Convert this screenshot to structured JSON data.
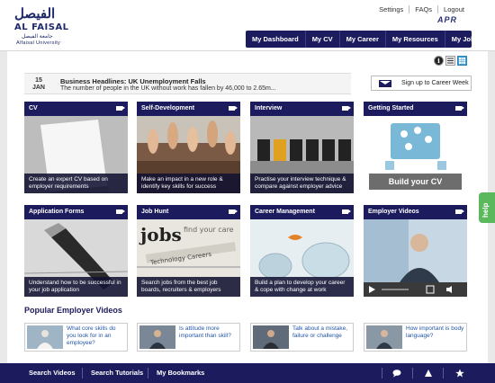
{
  "header": {
    "logo": {
      "arabic": "الفيصل",
      "latin": "AL FAISAL",
      "sub_arabic": "جامعة الفيصل",
      "sub": "Alfaisal University"
    },
    "util_links": [
      "Settings",
      "FAQs",
      "Logout"
    ],
    "apr_logo": "APR",
    "nav": [
      "My Dashboard",
      "My CV",
      "My Career",
      "My Resources",
      "My Jobs"
    ]
  },
  "view_toggle": [
    "info-icon",
    "list-icon",
    "grid-icon"
  ],
  "news": {
    "day": "15",
    "month": "JAN",
    "headline": "Business Headlines: UK Unemployment Falls",
    "body": "The number of people in the UK without work has fallen by 46,000 to 2.65m..."
  },
  "signup": {
    "label": "Sign up to Career Week",
    "icon": "mail-icon"
  },
  "tiles": [
    {
      "title": "CV",
      "caption": "Create an expert CV based on employer requirements",
      "icon": "video-camera-icon"
    },
    {
      "title": "Self-Development",
      "caption": "Make an impact in a new role & identify key skills for success",
      "icon": "video-camera-icon"
    },
    {
      "title": "Interview",
      "caption": "Practise your interview technique & compare against employer advice",
      "icon": "video-camera-icon"
    },
    {
      "title": "Getting Started",
      "caption": "Build your CV",
      "icon": "video-camera-icon"
    },
    {
      "title": "Application Forms",
      "caption": "Understand how to be successful in your job application",
      "icon": "video-camera-icon"
    },
    {
      "title": "Job Hunt",
      "caption": "Search jobs from the best job boards, recruiters & employers",
      "icon": "video-camera-icon"
    },
    {
      "title": "Career Management",
      "caption": "Build a plan to develop your career & cope with change at work",
      "icon": "video-camera-icon"
    },
    {
      "title": "Employer Videos",
      "caption": "",
      "icon": "video-camera-icon"
    }
  ],
  "popular": {
    "title": "Popular Employer Videos",
    "videos": [
      {
        "text": "What core skills do you look for in an employee?"
      },
      {
        "text": "Is attitude more important than skill?"
      },
      {
        "text": "Talk about a mistake, failure or challenge"
      },
      {
        "text": "How important is body language?"
      }
    ]
  },
  "bottom": {
    "links": [
      "Search Videos",
      "Search Tutorials",
      "My Bookmarks"
    ],
    "icons": [
      "chat-icon",
      "cone-icon",
      "star-icon"
    ]
  },
  "help": "help",
  "colors": {
    "navy": "#1c1b5e",
    "help_green": "#5cb85c",
    "link_blue": "#2255aa"
  }
}
